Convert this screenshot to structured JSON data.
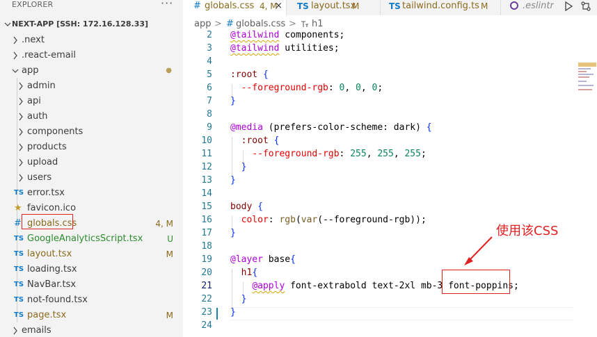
{
  "explorer": {
    "title": "EXPLORER",
    "more_label": "···",
    "section_title": "NEXT-APP [SSH: 172.16.128.33]",
    "items": [
      {
        "label": ".next",
        "kind": "folder",
        "expanded": false,
        "depth": 0,
        "status": ""
      },
      {
        "label": ".react-email",
        "kind": "folder",
        "expanded": false,
        "depth": 0,
        "status": ""
      },
      {
        "label": "app",
        "kind": "folder",
        "expanded": true,
        "depth": 0,
        "status": "●"
      },
      {
        "label": "admin",
        "kind": "folder",
        "expanded": false,
        "depth": 1,
        "status": ""
      },
      {
        "label": "api",
        "kind": "folder",
        "expanded": false,
        "depth": 1,
        "status": ""
      },
      {
        "label": "auth",
        "kind": "folder",
        "expanded": false,
        "depth": 1,
        "status": ""
      },
      {
        "label": "components",
        "kind": "folder",
        "expanded": false,
        "depth": 1,
        "status": ""
      },
      {
        "label": "products",
        "kind": "folder",
        "expanded": false,
        "depth": 1,
        "status": ""
      },
      {
        "label": "upload",
        "kind": "folder",
        "expanded": false,
        "depth": 1,
        "status": ""
      },
      {
        "label": "users",
        "kind": "folder",
        "expanded": false,
        "depth": 1,
        "status": ""
      },
      {
        "label": "error.tsx",
        "kind": "ts",
        "depth": 1,
        "status": ""
      },
      {
        "label": "favicon.ico",
        "kind": "ico",
        "depth": 1,
        "status": ""
      },
      {
        "label": "globals.css",
        "kind": "css",
        "depth": 1,
        "status": "4, M"
      },
      {
        "label": "GoogleAnalyticsScript.tsx",
        "kind": "ts",
        "depth": 1,
        "status": "U"
      },
      {
        "label": "layout.tsx",
        "kind": "ts",
        "depth": 1,
        "status": "M"
      },
      {
        "label": "loading.tsx",
        "kind": "ts",
        "depth": 1,
        "status": ""
      },
      {
        "label": "NavBar.tsx",
        "kind": "ts",
        "depth": 1,
        "status": ""
      },
      {
        "label": "not-found.tsx",
        "kind": "ts",
        "depth": 1,
        "status": ""
      },
      {
        "label": "page.tsx",
        "kind": "ts",
        "depth": 1,
        "status": "M"
      },
      {
        "label": "emails",
        "kind": "folder",
        "expanded": false,
        "depth": 0,
        "status": ""
      }
    ]
  },
  "icons": {
    "ts": "TS",
    "css": "#",
    "ico": "★"
  },
  "tabs": [
    {
      "icon": "#",
      "label": "globals.css",
      "status": "4, M",
      "close": "×",
      "active": true
    },
    {
      "icon": "TS",
      "label": "layout.tsx",
      "status": "M",
      "active": false
    },
    {
      "icon": "TS",
      "label": "tailwind.config.ts",
      "status": "M",
      "active": false
    },
    {
      "label": ".eslintrc",
      "active": false
    }
  ],
  "breadcrumb": {
    "folder": "app",
    "file_icon": "#",
    "file": "globals.css",
    "symbol": "h1",
    "sep": ">"
  },
  "code": {
    "lines": [
      {
        "n": "2",
        "text": "@tailwind components;"
      },
      {
        "n": "3",
        "text": "@tailwind utilities;"
      },
      {
        "n": "4",
        "text": ""
      },
      {
        "n": "5",
        "text": ":root {"
      },
      {
        "n": "6",
        "text": "  --foreground-rgb: 0, 0, 0;"
      },
      {
        "n": "7",
        "text": "}"
      },
      {
        "n": "8",
        "text": ""
      },
      {
        "n": "9",
        "text": "@media (prefers-color-scheme: dark) {"
      },
      {
        "n": "10",
        "text": "  :root {"
      },
      {
        "n": "11",
        "text": "    --foreground-rgb: 255, 255, 255;"
      },
      {
        "n": "12",
        "text": "  }"
      },
      {
        "n": "13",
        "text": "}"
      },
      {
        "n": "14",
        "text": ""
      },
      {
        "n": "15",
        "text": "body {"
      },
      {
        "n": "16",
        "text": "  color: rgb(var(--foreground-rgb));"
      },
      {
        "n": "17",
        "text": "}"
      },
      {
        "n": "18",
        "text": ""
      },
      {
        "n": "19",
        "text": "@layer base{"
      },
      {
        "n": "20",
        "text": "  h1{"
      },
      {
        "n": "21",
        "text": "    @apply font-extrabold text-2xl mb-3 font-poppins;"
      },
      {
        "n": "22",
        "text": "  }"
      },
      {
        "n": "23",
        "text": "}"
      },
      {
        "n": "24",
        "text": ""
      }
    ],
    "current_line": "21"
  },
  "annotation": {
    "text": "使用该CSS"
  },
  "colors": {
    "annotation": "#e02020",
    "modified": "#8a6a1c",
    "untracked": "#2e8b2e",
    "ts_icon": "#0f7bc7"
  }
}
